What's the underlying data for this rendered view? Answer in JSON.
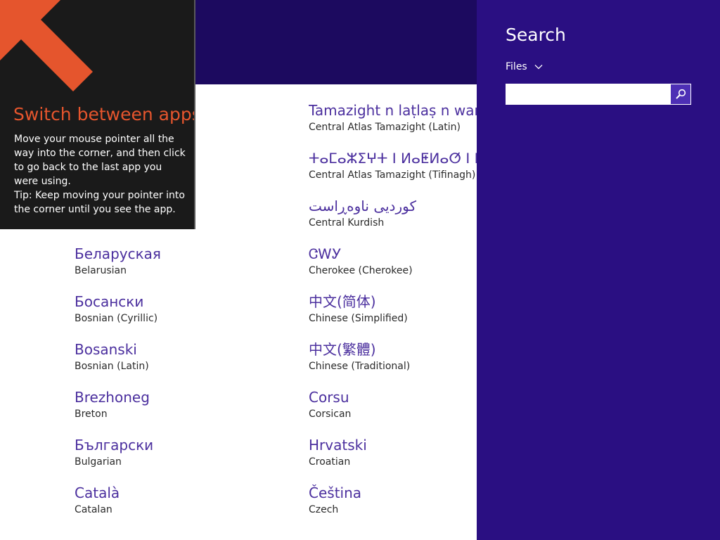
{
  "tip": {
    "title": "Switch between apps",
    "body_lines": [
      "Move your mouse pointer all the way into the corner, and then click to go back to the last app you were using.",
      "Tip: Keep moving your pointer into the corner until you see the app."
    ]
  },
  "languages": {
    "left_column": [
      {
        "native": "Беларуская",
        "english": "Belarusian"
      },
      {
        "native": "Босански",
        "english": "Bosnian (Cyrillic)"
      },
      {
        "native": "Bosanski",
        "english": "Bosnian (Latin)"
      },
      {
        "native": "Brezhoneg",
        "english": "Breton"
      },
      {
        "native": "Български",
        "english": "Bulgarian"
      },
      {
        "native": "Català",
        "english": "Catalan"
      }
    ],
    "right_column": [
      {
        "native": "Tamazight n laṭlaṣ n wammas",
        "english": "Central Atlas Tamazight (Latin)"
      },
      {
        "native": "ⵜⴰⵎⴰⵣⵉⵖⵜ ⵏ ⵍⴰⵟⵍⴰⵚ ⵏ ⵡⴰⵎⵎⴰⵙ",
        "english": "Central Atlas Tamazight (Tifinagh)"
      },
      {
        "native": "کوردیی ناوەڕاست",
        "english": "Central Kurdish"
      },
      {
        "native": "ᏣᎳᎩ",
        "english": "Cherokee (Cherokee)"
      },
      {
        "native": "中文(简体)",
        "english": "Chinese (Simplified)"
      },
      {
        "native": "中文(繁體)",
        "english": "Chinese (Traditional)"
      },
      {
        "native": "Corsu",
        "english": "Corsican"
      },
      {
        "native": "Hrvatski",
        "english": "Croatian"
      },
      {
        "native": "Čeština",
        "english": "Czech"
      }
    ]
  },
  "search_charm": {
    "title": "Search",
    "scope": "Files",
    "input_value": "",
    "icons": {
      "scope_dropdown": "chevron-down-icon",
      "submit": "search-icon"
    }
  },
  "colors": {
    "header_band": "#1c0a5f",
    "charm_bg": "#2a0f82",
    "accent_text": "#4b2f9e",
    "tip_title": "#e5552d",
    "tip_arrow": "#e5552d",
    "search_button": "#4d2fb5"
  }
}
